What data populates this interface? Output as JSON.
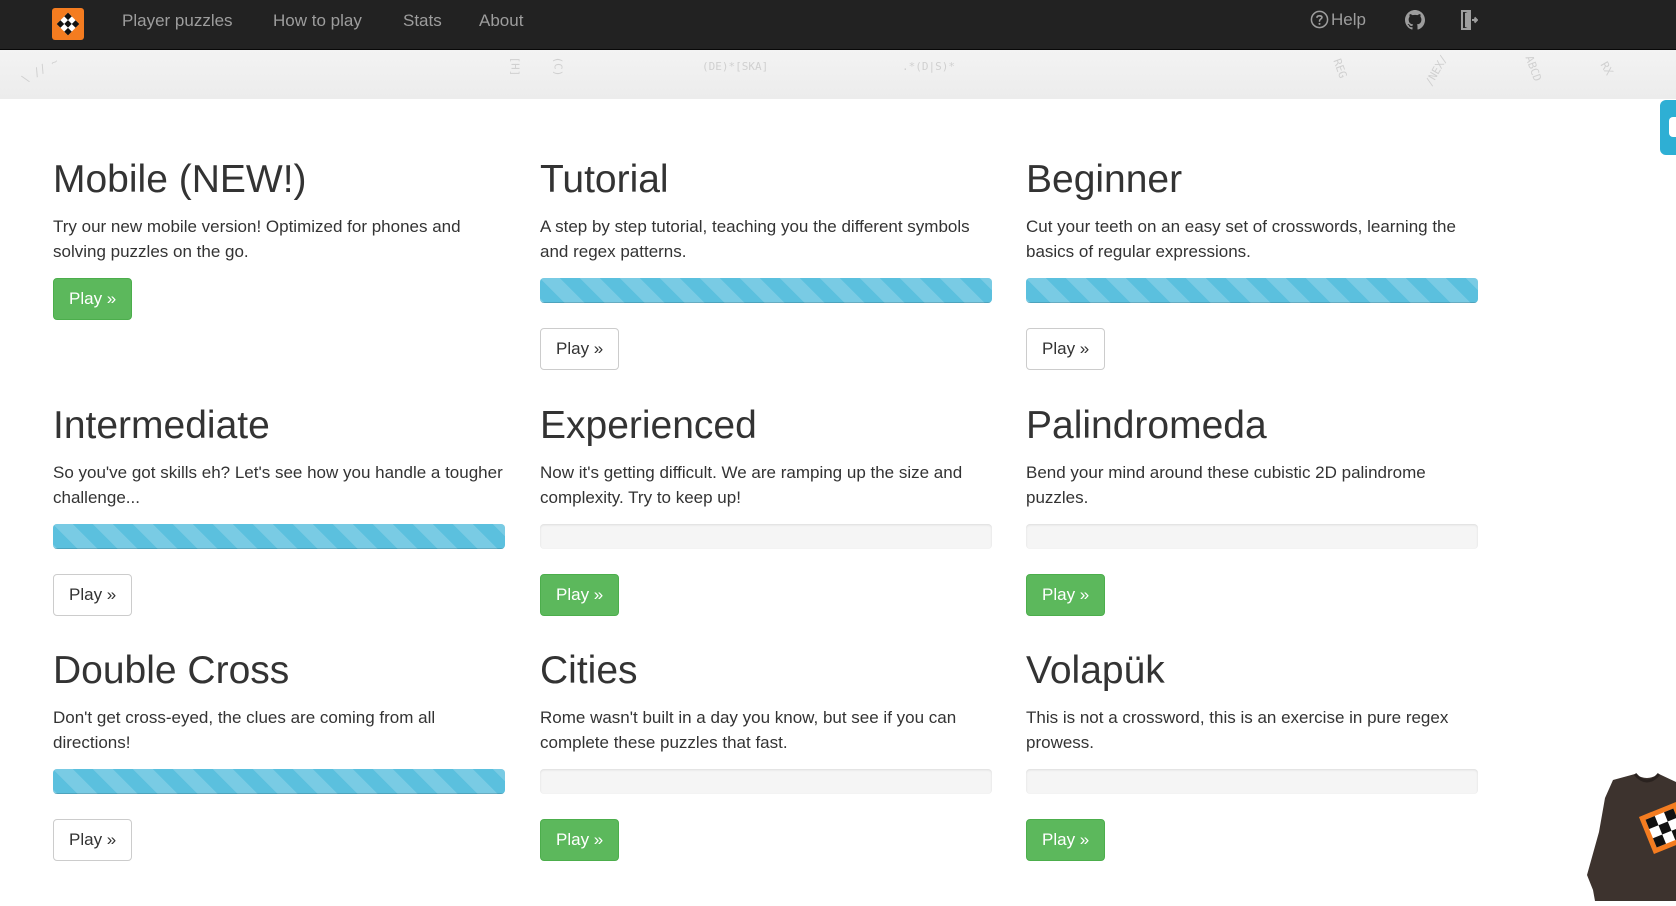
{
  "nav": {
    "logo_icon": "crossword-logo-icon",
    "links": [
      "Player puzzles",
      "How to play",
      "Stats",
      "About"
    ],
    "help_label": "Help",
    "help_icon": "question-circle-icon",
    "github_icon": "github-icon",
    "signout_icon": "sign-out-icon"
  },
  "colors": {
    "navbar": "#222222",
    "brand_orange": "#f47c20",
    "success_green": "#5cb85c",
    "progress_blue": "#5bc0de",
    "side_tab": "#2eafd4"
  },
  "puzzles": [
    {
      "title": "Mobile (NEW!)",
      "description": "Try our new mobile version! Optimized for phones and solving puzzles on the go.",
      "has_progress": false,
      "progress": null,
      "button_style": "success",
      "button_label": "Play »"
    },
    {
      "title": "Tutorial",
      "description": "A step by step tutorial, teaching you the different symbols and regex patterns.",
      "has_progress": true,
      "progress": 1.0,
      "button_style": "default",
      "button_label": "Play »"
    },
    {
      "title": "Beginner",
      "description": "Cut your teeth on an easy set of crosswords, learning the basics of regular expressions.",
      "has_progress": true,
      "progress": 1.0,
      "button_style": "default",
      "button_label": "Play »"
    },
    {
      "title": "Intermediate",
      "description": "So you've got skills eh? Let's see how you handle a tougher challenge...",
      "has_progress": true,
      "progress": 1.0,
      "button_style": "default",
      "button_label": "Play »"
    },
    {
      "title": "Experienced",
      "description": "Now it's getting difficult. We are ramping up the size and complexity. Try to keep up!",
      "has_progress": true,
      "progress": 0.0,
      "button_style": "success",
      "button_label": "Play »"
    },
    {
      "title": "Palindromeda",
      "description": "Bend your mind around these cubistic 2D palindrome puzzles.",
      "has_progress": true,
      "progress": 0.0,
      "button_style": "success",
      "button_label": "Play »"
    },
    {
      "title": "Double Cross",
      "description": "Don't get cross-eyed, the clues are coming from all directions!",
      "has_progress": true,
      "progress": 1.0,
      "button_style": "default",
      "button_label": "Play »"
    },
    {
      "title": "Cities",
      "description": "Rome wasn't built in a day you know, but see if you can complete these puzzles that fast.",
      "has_progress": true,
      "progress": 0.0,
      "button_style": "success",
      "button_label": "Play »"
    },
    {
      "title": "Volapük",
      "description": "This is not a crossword, this is an exercise in pure regex prowess.",
      "has_progress": true,
      "progress": 0.0,
      "button_style": "success",
      "button_label": "Play »"
    }
  ],
  "promo": {
    "icon": "tshirt-promo-icon"
  }
}
